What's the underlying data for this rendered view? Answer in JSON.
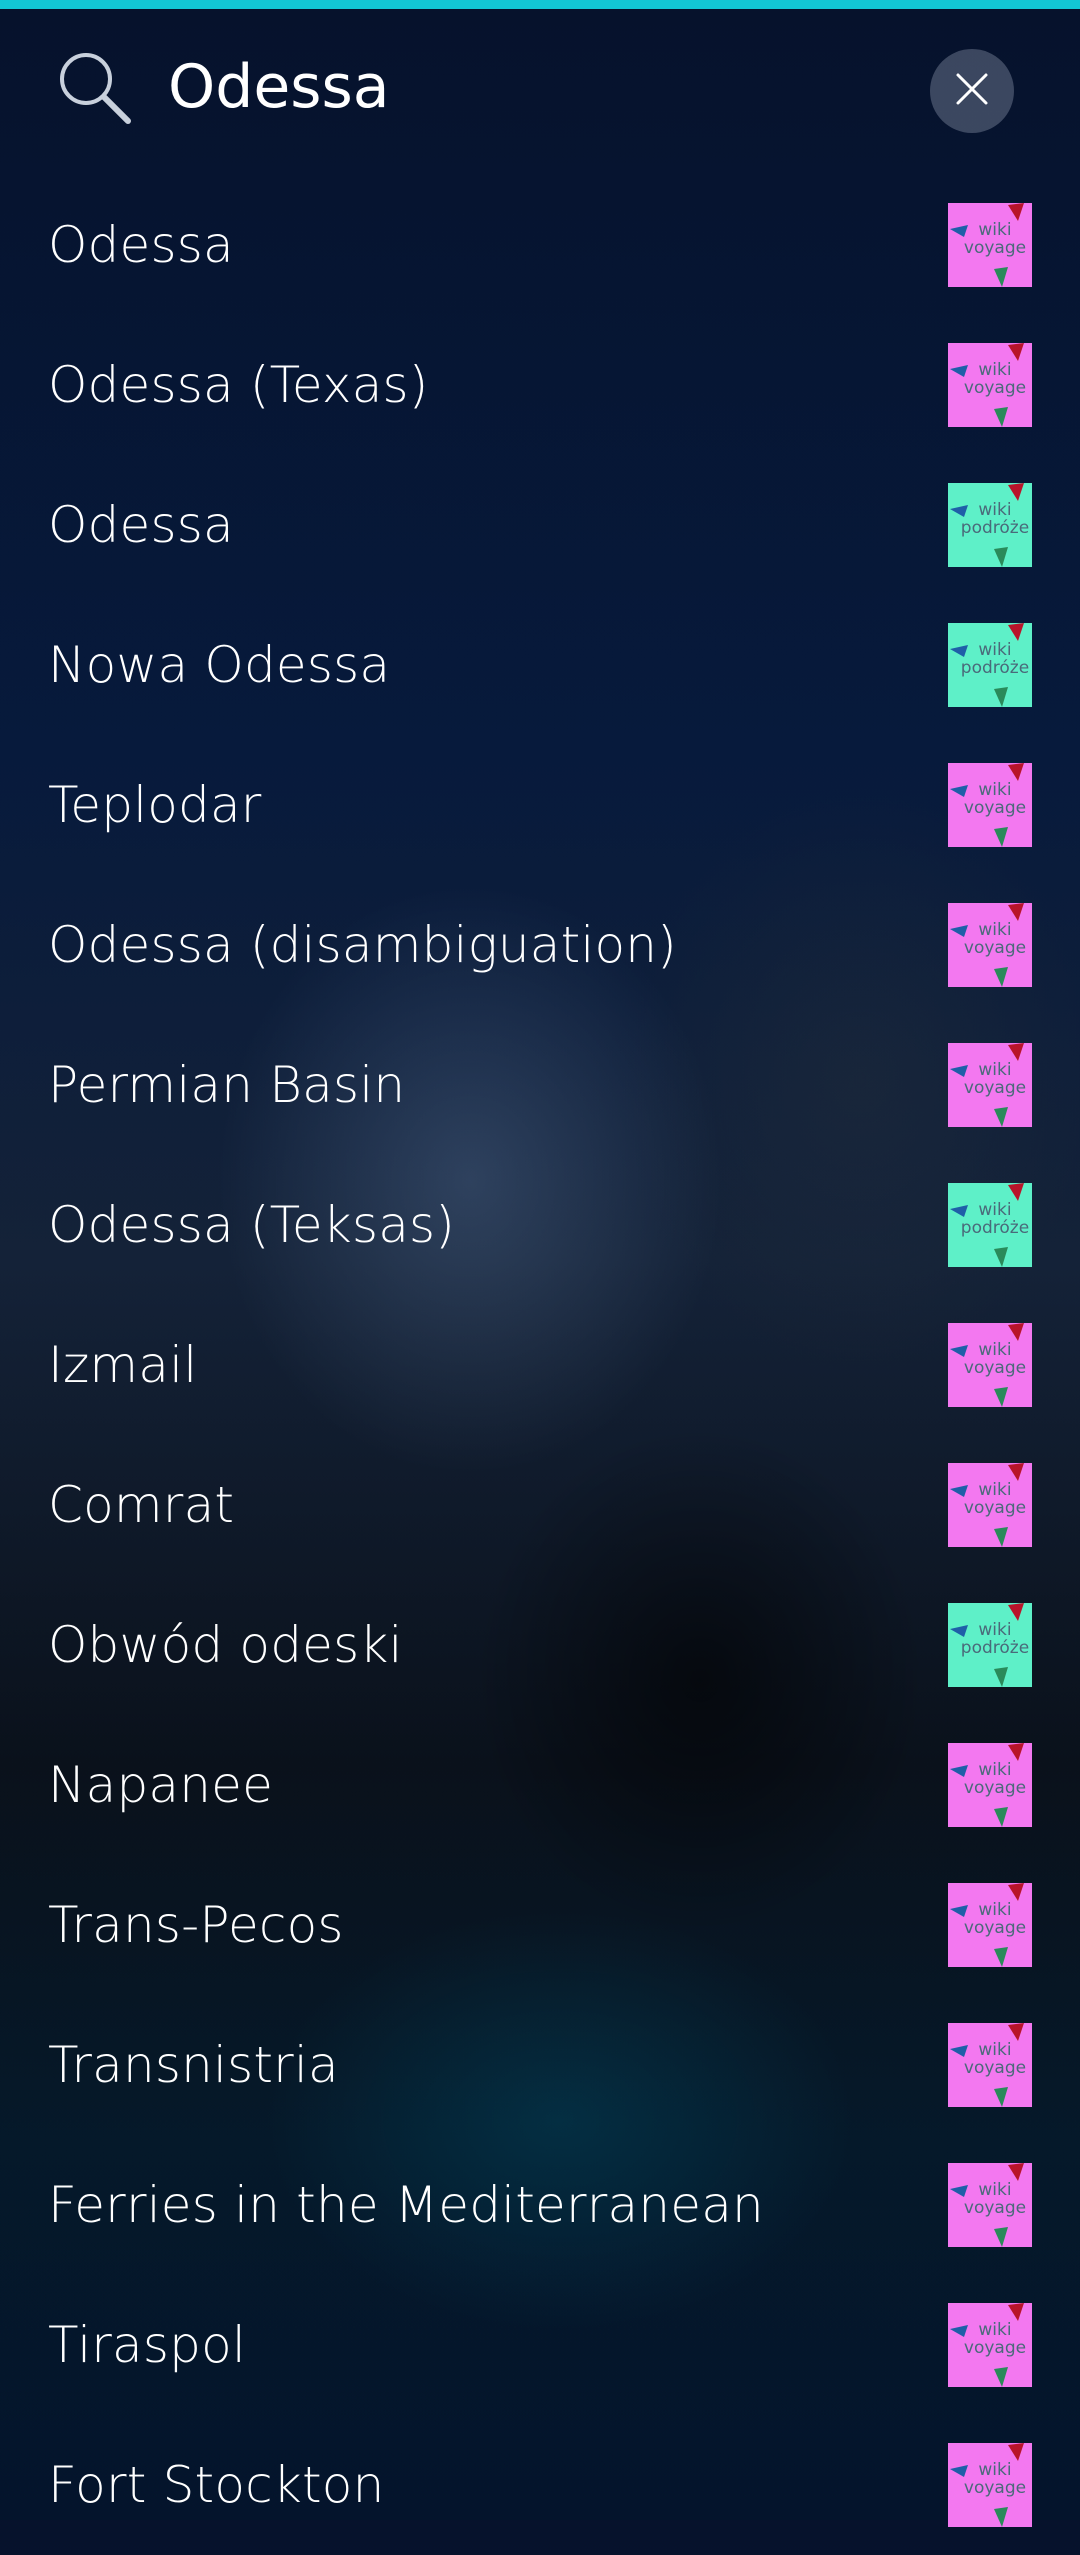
{
  "search": {
    "value": "Odessa",
    "icon": "search-icon",
    "clear_icon": "close-icon"
  },
  "colors": {
    "accent": "#12c6d4",
    "wikivoyage": "#f378f0",
    "wikipodroze": "#5ef0c8",
    "logo_arrow_red": "#b8142a",
    "logo_arrow_blue": "#1f5fa8",
    "logo_arrow_green": "#2a8a5a"
  },
  "results": [
    {
      "title": "Odessa",
      "source": "wikivoyage",
      "logo_top": "wiki",
      "logo_bottom": "voyage"
    },
    {
      "title": "Odessa (Texas)",
      "source": "wikivoyage",
      "logo_top": "wiki",
      "logo_bottom": "voyage"
    },
    {
      "title": "Odessa",
      "source": "wikipodroze",
      "logo_top": "wiki",
      "logo_bottom": "podróże"
    },
    {
      "title": "Nowa Odessa",
      "source": "wikipodroze",
      "logo_top": "wiki",
      "logo_bottom": "podróże"
    },
    {
      "title": "Teplodar",
      "source": "wikivoyage",
      "logo_top": "wiki",
      "logo_bottom": "voyage"
    },
    {
      "title": "Odessa (disambiguation)",
      "source": "wikivoyage",
      "logo_top": "wiki",
      "logo_bottom": "voyage"
    },
    {
      "title": "Permian Basin",
      "source": "wikivoyage",
      "logo_top": "wiki",
      "logo_bottom": "voyage"
    },
    {
      "title": "Odessa (Teksas)",
      "source": "wikipodroze",
      "logo_top": "wiki",
      "logo_bottom": "podróże"
    },
    {
      "title": "Izmail",
      "source": "wikivoyage",
      "logo_top": "wiki",
      "logo_bottom": "voyage"
    },
    {
      "title": "Comrat",
      "source": "wikivoyage",
      "logo_top": "wiki",
      "logo_bottom": "voyage"
    },
    {
      "title": "Obwód odeski",
      "source": "wikipodroze",
      "logo_top": "wiki",
      "logo_bottom": "podróże"
    },
    {
      "title": "Napanee",
      "source": "wikivoyage",
      "logo_top": "wiki",
      "logo_bottom": "voyage"
    },
    {
      "title": "Trans-Pecos",
      "source": "wikivoyage",
      "logo_top": "wiki",
      "logo_bottom": "voyage"
    },
    {
      "title": "Transnistria",
      "source": "wikivoyage",
      "logo_top": "wiki",
      "logo_bottom": "voyage"
    },
    {
      "title": "Ferries in the Mediterranean",
      "source": "wikivoyage",
      "logo_top": "wiki",
      "logo_bottom": "voyage"
    },
    {
      "title": "Tiraspol",
      "source": "wikivoyage",
      "logo_top": "wiki",
      "logo_bottom": "voyage"
    },
    {
      "title": "Fort Stockton",
      "source": "wikivoyage",
      "logo_top": "wiki",
      "logo_bottom": "voyage"
    }
  ]
}
